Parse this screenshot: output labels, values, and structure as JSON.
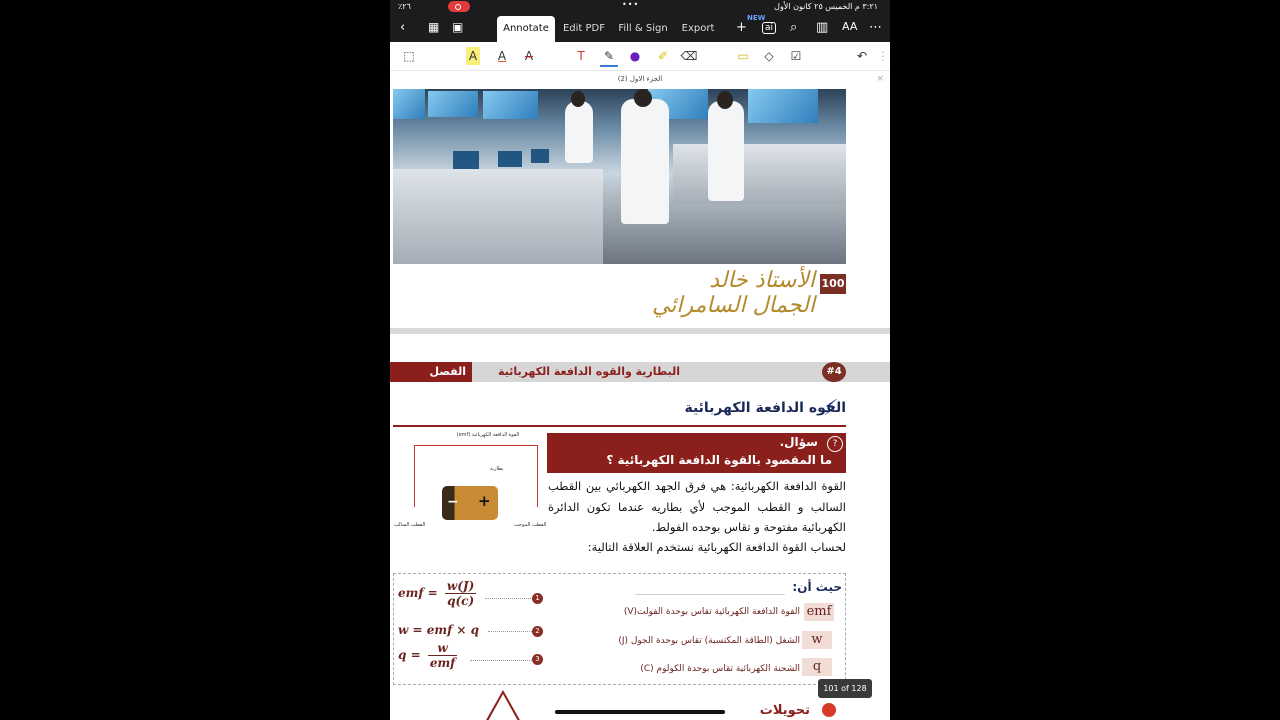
{
  "status": {
    "time": "٣:٢١ م  الخميس ٢٥ كانون الأول",
    "battery": "٪٢٦"
  },
  "nav": {
    "tabs": [
      {
        "label": "Annotate"
      },
      {
        "label": "Edit PDF"
      },
      {
        "label": "Fill & Sign"
      },
      {
        "label": "Export"
      }
    ],
    "new_badge": "NEW",
    "ai_label": "ai"
  },
  "doc": {
    "title": "الجزء الاول (2)",
    "page_number": "100",
    "logo_text": "الأستاذ خالد الجمال السامرائي",
    "header": {
      "chapter": "الفصل الرابع",
      "subtitle": "البطارية والقوه الدافعة الكهربائية",
      "num": "#4"
    },
    "section_title": "القوه الدافعة الكهربائية",
    "diagram": {
      "title": "القوة الدافعة الكهربائية (emf)",
      "battery": "بطارية",
      "neg": "القطب السالب",
      "pos": "القطب الموجب"
    },
    "question": {
      "label": "سؤال.",
      "text": "ما المقصود بالقوة الدافعة الكهربائية ؟"
    },
    "answer": "القوة الدافعة الكهربائية: هي فرق الجهد الكهربائي بين القطب السالب و القطب الموجب لأي بطاريه عندما تكون الدائرة الكهربائية مفتوحة و تقاس بوحده الفولط.",
    "note": "لحساب القوة الدافعة الكهربائية نستخدم العلاقة التالية:",
    "formulas": [
      {
        "lhs": "emf =",
        "num": "w(J)",
        "den": "q(c)",
        "n": "1"
      },
      {
        "lhs": "w =  emf × q",
        "n": "2"
      },
      {
        "lhs": "q =",
        "num": "w",
        "den": "emf",
        "n": "3"
      }
    ],
    "where_label": "حيث أن:",
    "definitions": [
      {
        "sym": "emf",
        "text": "القوة الدافعة الكهربائية تقاس بوحدة الفولت(V)"
      },
      {
        "sym": "w",
        "text": "الشغل (الطاقة المكتسبة) تقاس بوحدة الجول (J)"
      },
      {
        "sym": "q",
        "text": "الشحنة الكهربائية تقاس بوحدة الكولوم (C)"
      }
    ],
    "bottom_title": "تحويلات",
    "page_indicator": "101 of 128"
  }
}
